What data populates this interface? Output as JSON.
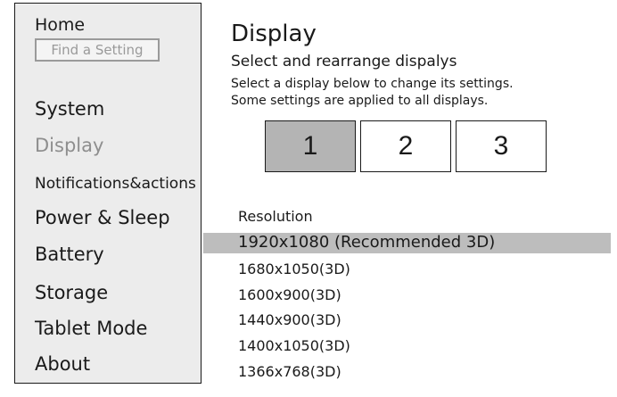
{
  "sidebar": {
    "home_label": "Home",
    "search_placeholder": "Find a Setting",
    "items": [
      {
        "label": "System"
      },
      {
        "label": "Display"
      },
      {
        "label": "Notifications&actions"
      },
      {
        "label": "Power & Sleep"
      },
      {
        "label": "Battery"
      },
      {
        "label": "Storage"
      },
      {
        "label": "Tablet Mode"
      },
      {
        "label": "About"
      }
    ],
    "active_item": "Display"
  },
  "main": {
    "title": "Display",
    "subtitle": "Select and rearrange dispalys",
    "desc_line1": "Select a display below to change its settings.",
    "desc_line2": "Some settings are applied to all displays.",
    "displays": [
      {
        "label": "1",
        "selected": true
      },
      {
        "label": "2",
        "selected": false
      },
      {
        "label": "3",
        "selected": false
      }
    ],
    "resolution_label": "Resolution",
    "resolutions": [
      {
        "label": "1920x1080 (Recommended 3D)",
        "selected": true
      },
      {
        "label": "1680x1050(3D)",
        "selected": false
      },
      {
        "label": "1600x900(3D)",
        "selected": false
      },
      {
        "label": "1440x900(3D)",
        "selected": false
      },
      {
        "label": "1400x1050(3D)",
        "selected": false
      },
      {
        "label": "1366x768(3D)",
        "selected": false
      }
    ]
  },
  "colors": {
    "sidebar_bg": "#ececec",
    "active_text": "#8e8e8e",
    "selected_display": "#b4b4b4",
    "selected_resolution": "#bdbdbd"
  }
}
